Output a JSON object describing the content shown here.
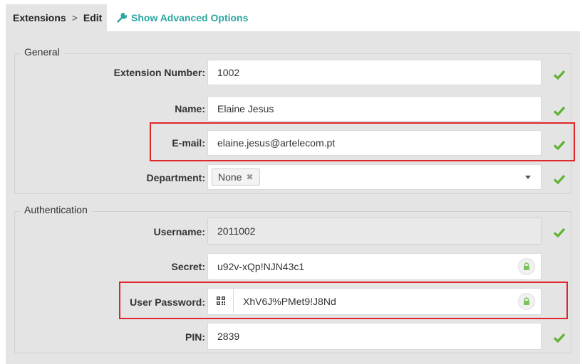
{
  "breadcrumb": {
    "root": "Extensions",
    "separator": ">",
    "current": "Edit"
  },
  "advanced_link": {
    "label": "Show Advanced Options",
    "icon": "wrench-icon",
    "color": "#2aa6a0"
  },
  "general": {
    "legend": "General",
    "extension_number": {
      "label": "Extension Number:",
      "value": "1002"
    },
    "name": {
      "label": "Name:",
      "value": "Elaine Jesus"
    },
    "email": {
      "label": "E-mail:",
      "value": "elaine.jesus@artelecom.pt"
    },
    "department": {
      "label": "Department:",
      "tag": "None",
      "remove_glyph": "✖"
    }
  },
  "authentication": {
    "legend": "Authentication",
    "username": {
      "label": "Username:",
      "value": "2011002"
    },
    "secret": {
      "label": "Secret:",
      "value": "u92v-xQp!NJN43c1"
    },
    "user_password": {
      "label": "User Password:",
      "value": "XhV6J%PMet9!J8Nd"
    },
    "pin": {
      "label": "PIN:",
      "value": "2839"
    }
  },
  "colors": {
    "check": "#5fb233",
    "highlight": "#e0262b",
    "panel": "#e4e4e4"
  }
}
